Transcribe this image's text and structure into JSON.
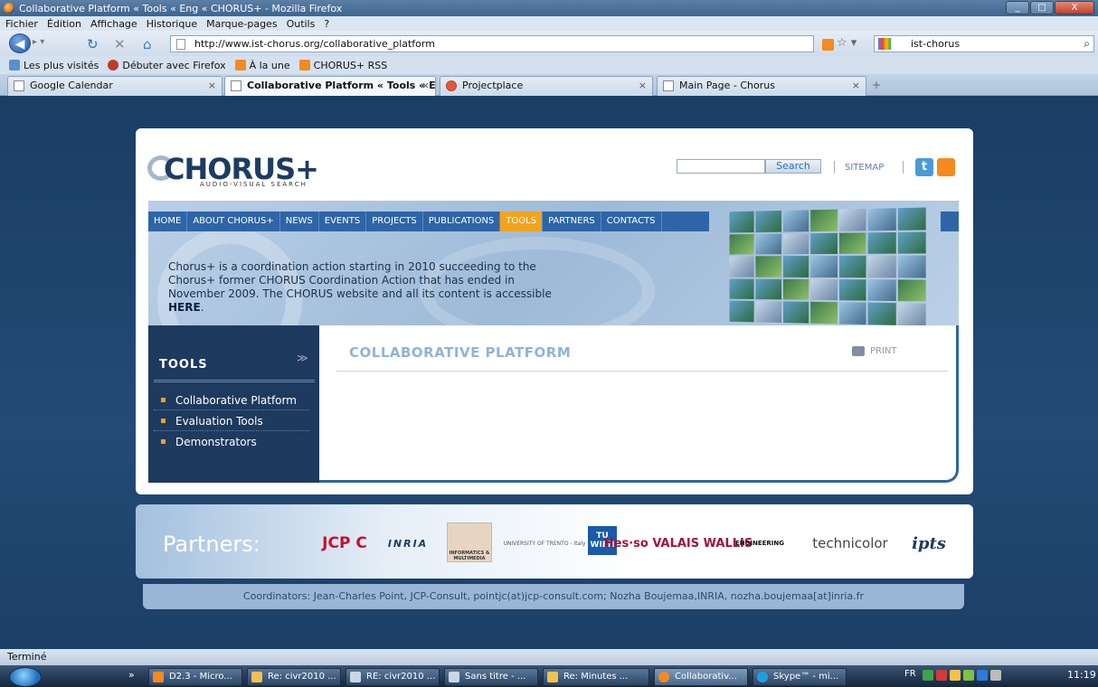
{
  "window": {
    "title": "Collaborative Platform « Tools « Eng « CHORUS+ - Mozilla Firefox",
    "controls": [
      "_",
      "□",
      "X"
    ]
  },
  "menu": [
    "Fichier",
    "Édition",
    "Affichage",
    "Historique",
    "Marque-pages",
    "Outils",
    "?"
  ],
  "toolbar": {
    "url": "http://www.ist-chorus.org/collaborative_platform",
    "search_value": "ist-chorus"
  },
  "bookmarks": [
    "Les plus visités",
    "Débuter avec Firefox",
    "À la une",
    "CHORUS+ RSS"
  ],
  "tabs": [
    {
      "label": "Google Calendar"
    },
    {
      "label": "Collaborative Platform « Tools « E..."
    },
    {
      "label": "Projectplace"
    },
    {
      "label": "Main Page - Chorus"
    }
  ],
  "site": {
    "logo_text": "CHORUS+",
    "logo_sub": "AUDIO-VISUAL SEARCH",
    "search_button": "Search",
    "sitemap": "SITEMAP",
    "nav": [
      "HOME",
      "ABOUT CHORUS+",
      "NEWS",
      "EVENTS",
      "PROJECTS",
      "PUBLICATIONS",
      "TOOLS",
      "PARTNERS",
      "CONTACTS"
    ],
    "active_nav": "TOOLS",
    "banner_text": "Chorus+ is a coordination action starting in 2010 succeeding to the Chorus+ former CHORUS Coordination Action that has ended in November 2009. The CHORUS website and all its content is accessible ",
    "banner_link": "HERE",
    "banner_end": ".",
    "sidebar_title": "TOOLS",
    "sidebar_items": [
      "Collaborative Platform",
      "Evaluation Tools",
      "Demonstrators"
    ],
    "content_title": "COLLABORATIVE PLATFORM",
    "print": "PRINT",
    "partners_label": "Partners:",
    "partner_logos": [
      "JCP C",
      "INRIA",
      "INFORMATICS & MULTIMEDIA",
      "UNIVERSITY OF TRENTO - Italy",
      "TU WIEN",
      "Hes·so VALAIS WALLIS",
      "ENGINEERING",
      "technicolor",
      "ipts"
    ],
    "coordinators": "Coordinators: Jean-Charles Point, JCP-Consult, pointjc(at)jcp-consult.com; Nozha Boujemaa,INRIA, nozha.boujemaa[at]inria.fr"
  },
  "status": "Terminé",
  "taskbar": {
    "items": [
      "D2.3 - Micro...",
      "Re: civr2010 ...",
      "RE: civr2010 ...",
      "Sans titre - ...",
      "Re: Minutes ...",
      "Collaborativ...",
      "Skype™ - mi..."
    ],
    "lang": "FR",
    "clock": "11:19"
  },
  "colors": {
    "accent": "#2d65a6",
    "active_tab": "#f2a31c",
    "page_bg": "#1c3f66"
  }
}
